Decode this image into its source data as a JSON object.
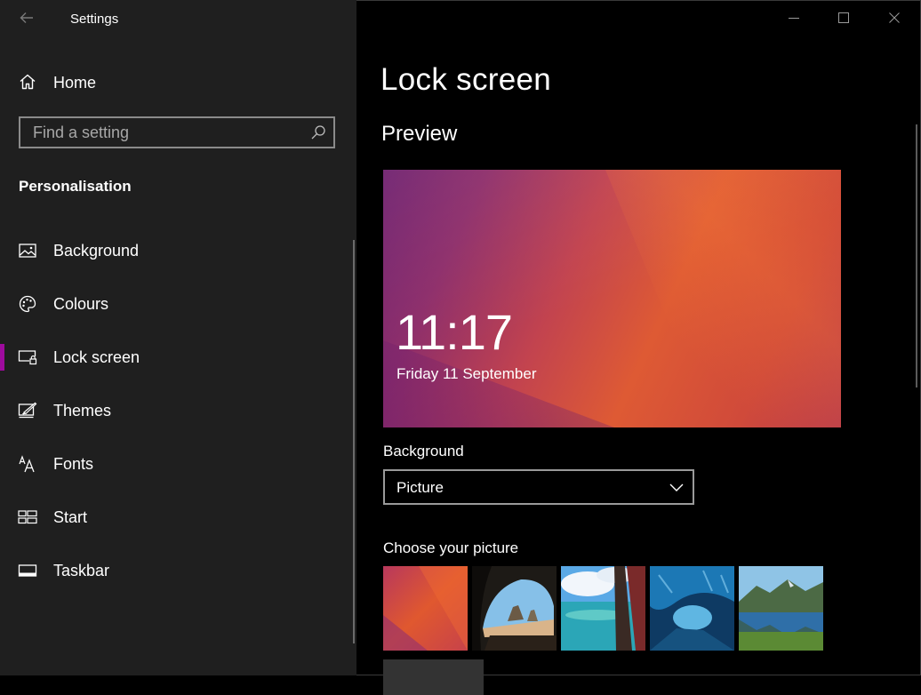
{
  "window": {
    "title": "Settings",
    "controls": [
      "minimize-icon",
      "maximize-icon",
      "close-icon"
    ]
  },
  "sidebar": {
    "home_label": "Home",
    "search_placeholder": "Find a setting",
    "section_heading": "Personalisation",
    "items": [
      {
        "label": "Background",
        "icon": "picture-icon",
        "selected": false
      },
      {
        "label": "Colours",
        "icon": "palette-icon",
        "selected": false
      },
      {
        "label": "Lock screen",
        "icon": "lock-screen-icon",
        "selected": true
      },
      {
        "label": "Themes",
        "icon": "themes-icon",
        "selected": false
      },
      {
        "label": "Fonts",
        "icon": "fonts-icon",
        "selected": false
      },
      {
        "label": "Start",
        "icon": "start-icon",
        "selected": false
      },
      {
        "label": "Taskbar",
        "icon": "taskbar-icon",
        "selected": false
      }
    ],
    "accent_color": "#9e0b9d"
  },
  "main": {
    "title": "Lock screen",
    "preview_heading": "Preview",
    "preview": {
      "time": "11:17",
      "date": "Friday 11 September"
    },
    "background": {
      "label": "Background",
      "selected": "Picture"
    },
    "choose_picture_label": "Choose your picture",
    "thumbnails": [
      "purple-orange-abstract",
      "beach-cave",
      "coast-cliff",
      "ice-cave",
      "mountain-lake"
    ]
  }
}
